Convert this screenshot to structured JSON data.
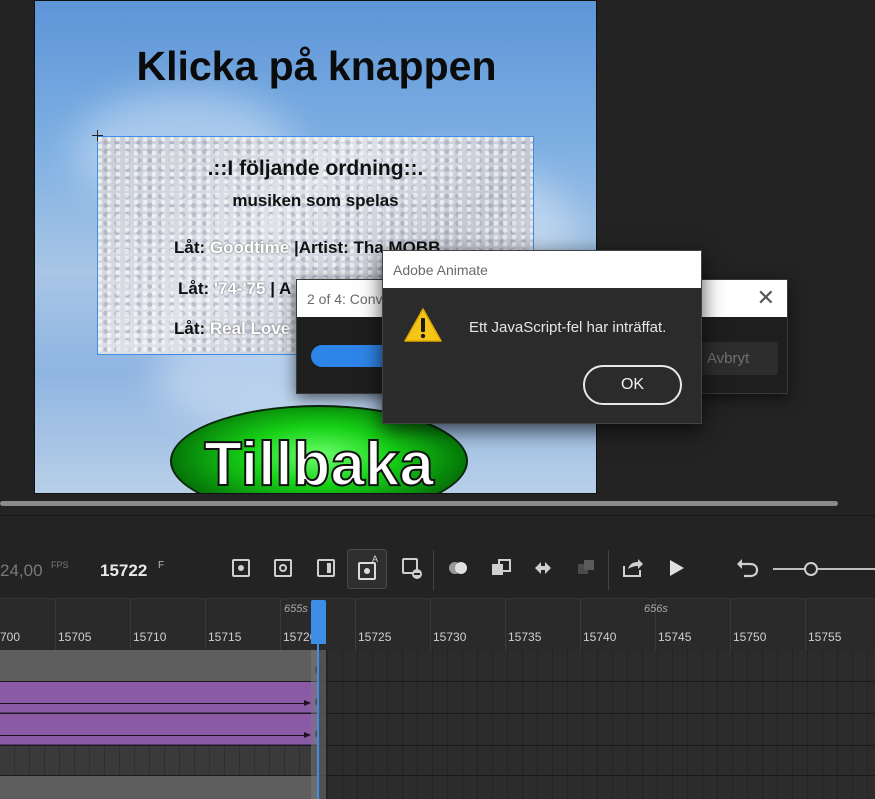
{
  "stage": {
    "title": "Klicka på knappen",
    "textbox": {
      "heading": ".::I följande ordning::.",
      "subheading": "musiken som spelas",
      "rows": [
        {
          "prefix": "Låt: ",
          "song": "Goodtime",
          "rest": " |Artist: Tha MOBB"
        },
        {
          "prefix": "Låt: ",
          "song": "'74-'75",
          "rest": " | A"
        },
        {
          "prefix": "Låt: ",
          "song": "Real Love",
          "rest": ""
        }
      ]
    },
    "button_label": "Tillbaka"
  },
  "progress_dialog": {
    "title": "2 of 4: Conv",
    "close_glyph": "✕",
    "cancel_label": "Avbryt"
  },
  "error_dialog": {
    "title": "Adobe Animate",
    "message": "Ett JavaScript-fel har inträffat.",
    "ok_label": "OK",
    "icon": "warning-icon"
  },
  "timeline": {
    "fps_value": "24,00",
    "fps_unit": "FPS",
    "current_frame": "15722",
    "frame_unit": "F",
    "seconds_labels": [
      "655s",
      "656s"
    ],
    "frame_labels": [
      "700",
      "15705",
      "15710",
      "15715",
      "15720",
      "15725",
      "15730",
      "15735",
      "15740",
      "15745",
      "15750",
      "15755"
    ]
  },
  "colors": {
    "accent": "#3d8ee6",
    "tween": "#8a5aa6",
    "warning": "#f5c518",
    "button_green": "#16d016"
  }
}
